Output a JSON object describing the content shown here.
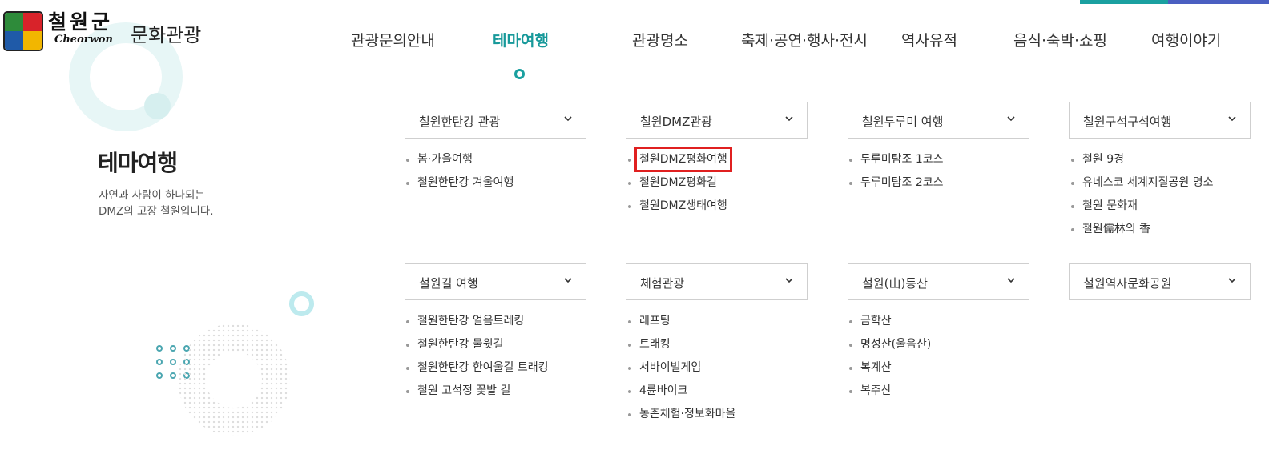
{
  "header": {
    "logo_text_kor": "철원군",
    "logo_text_eng": "Cheorwon",
    "site_title": "문화관광",
    "nav": [
      {
        "label": "관광문의안내"
      },
      {
        "label": "테마여행"
      },
      {
        "label": "관광명소"
      },
      {
        "label": "축제·공연·행사·전시"
      },
      {
        "label": "역사유적"
      },
      {
        "label": "음식·숙박·쇼핑"
      },
      {
        "label": "여행이야기"
      }
    ],
    "active_nav": "테마여행"
  },
  "intro": {
    "heading": "테마여행",
    "description": "자연과 사람이 하나되는\nDMZ의 고장 철원입니다."
  },
  "categories": [
    {
      "label": "철원한탄강 관광",
      "items": [
        "봄·가을여행",
        "철원한탄강 겨울여행"
      ]
    },
    {
      "label": "철원DMZ관광",
      "items": [
        "철원DMZ평화여행",
        "철원DMZ평화길",
        "철원DMZ생태여행"
      ]
    },
    {
      "label": "철원두루미 여행",
      "items": [
        "두루미탐조 1코스",
        "두루미탐조 2코스"
      ]
    },
    {
      "label": "철원구석구석여행",
      "items": [
        "철원 9경",
        "유네스코 세계지질공원 명소",
        "철원 문화재",
        "철원儒林의 香"
      ]
    },
    {
      "label": "철원길 여행",
      "items": [
        "철원한탄강 얼음트레킹",
        "철원한탄강 물윗길",
        "철원한탄강 한여울길 트래킹",
        "철원 고석정 꽃밭 길"
      ]
    },
    {
      "label": "체험관광",
      "items": [
        "래프팅",
        "트래킹",
        "서바이벌게임",
        "4륜바이크",
        "농촌체험·정보화마을"
      ]
    },
    {
      "label": "철원(山)등산",
      "items": [
        "금학산",
        "명성산(울음산)",
        "복계산",
        "복주산"
      ]
    },
    {
      "label": "철원역사문화공원",
      "items": []
    }
  ],
  "highlighted_item": "철원DMZ평화여행",
  "colors": {
    "accent": "#1aa0a0",
    "highlight_box": "#e02020",
    "bar_blue": "#4a5fc1"
  }
}
